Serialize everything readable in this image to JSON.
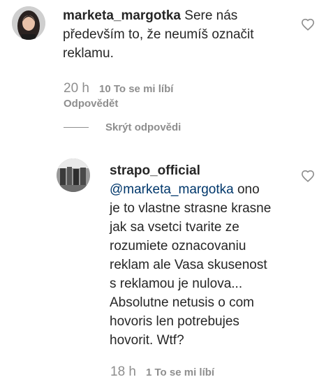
{
  "comment": {
    "username": "marketa_margotka",
    "text_line1": "Sere nás",
    "text_line2": "především to, že neumíš označit",
    "text_line3": "reklamu.",
    "time": "20 h",
    "likes": "10 To se mi líbí",
    "reply_label": "Odpovědět",
    "hide_replies_label": "Skrýt odpovědi",
    "heart_icon": "heart-outline-icon"
  },
  "reply": {
    "username": "strapo_official",
    "mention": "@marketa_margotka",
    "lines": [
      "ono",
      "je to vlastne strasne krasne",
      "jak sa vsetci tvarite ze",
      "rozumiete oznacovaniu",
      "reklam ale Vasa skusenost",
      "s reklamou je nulova...",
      "Absolutne netusis o com",
      "hovoris len potrebujes",
      "hovorit. Wtf?"
    ],
    "time": "18 h",
    "likes": "1 To se mi líbí",
    "heart_icon": "heart-outline-icon"
  },
  "colors": {
    "text": "#262626",
    "muted": "#8e8e8e",
    "mention": "#00376b"
  }
}
